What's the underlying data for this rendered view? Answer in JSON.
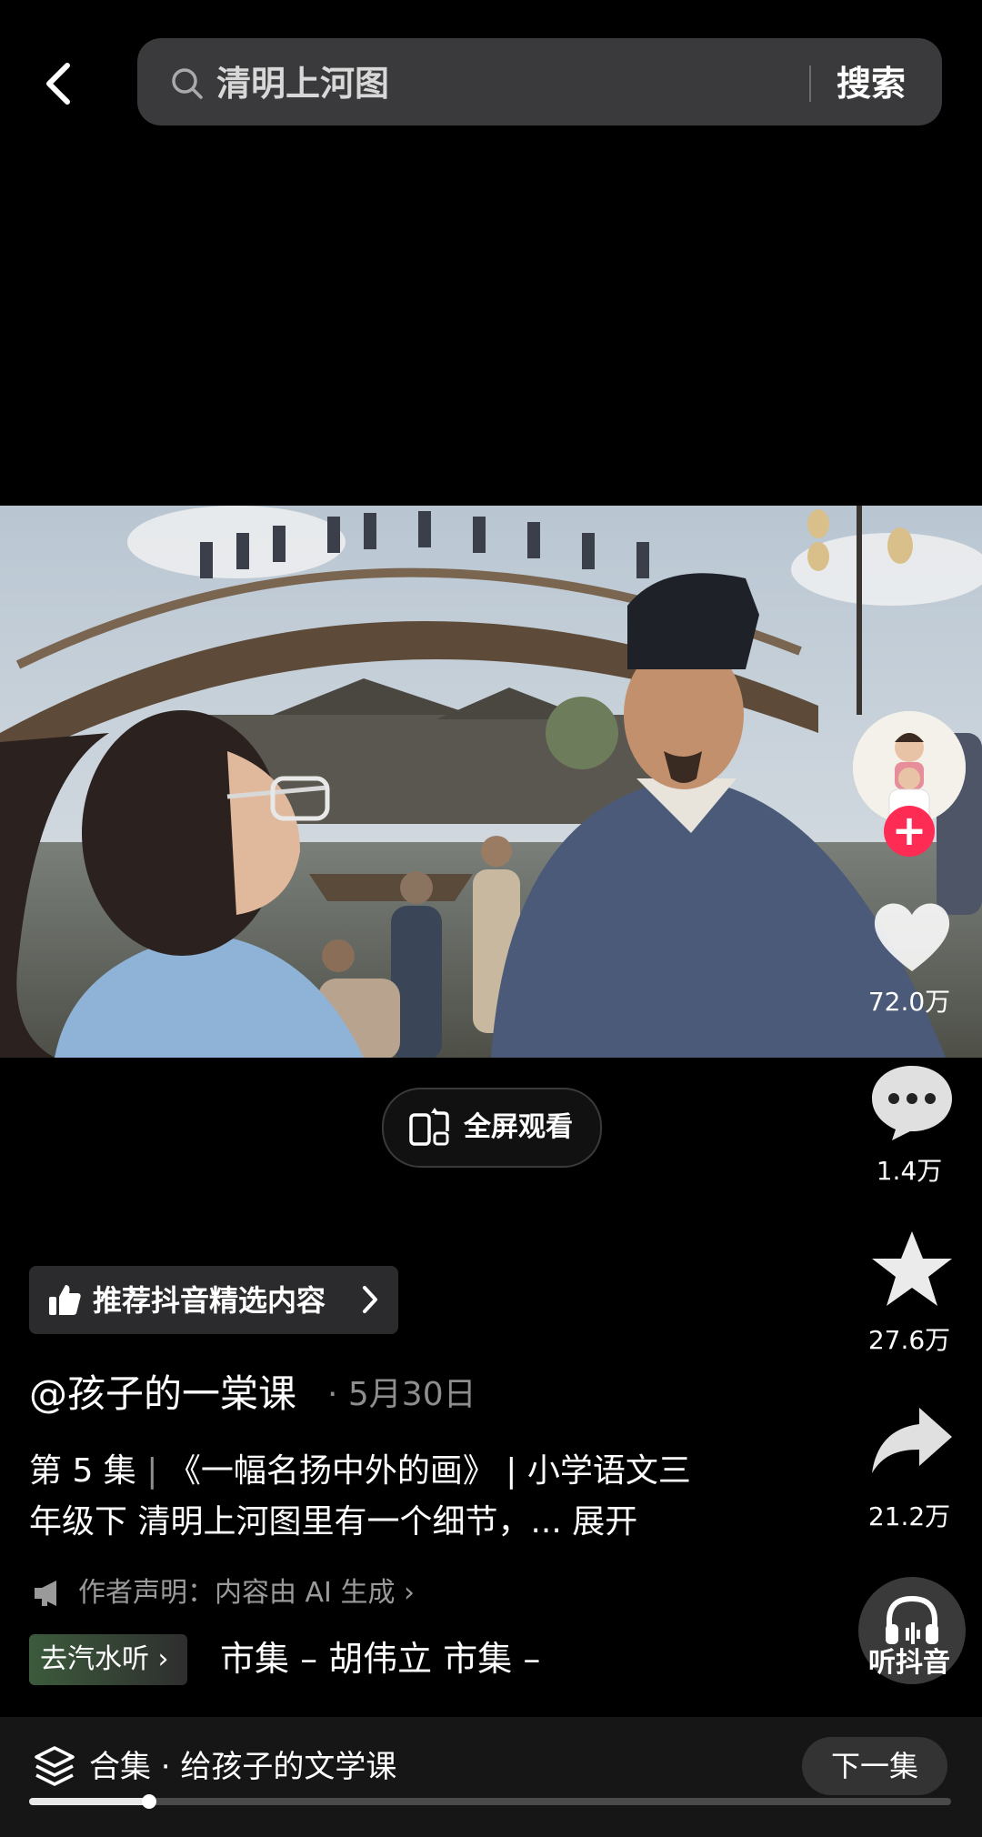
{
  "search": {
    "query": "清明上河图",
    "button_label": "搜索"
  },
  "player": {
    "fullscreen_label": "全屏观看"
  },
  "actions": {
    "likes": "72.0万",
    "comments": "1.4万",
    "favorites": "27.6万",
    "shares": "21.2万"
  },
  "recommend": {
    "label": "推荐抖音精选内容"
  },
  "post": {
    "author": "@孩子的一棠课",
    "date": "· 5月30日",
    "desc_line1_a": "第 5 集",
    "desc_line1_sep": "|",
    "desc_line1_b": "《一幅名扬中外的画》 | 小学语文三",
    "desc_line2": "年级下 清明上河图里有一个细节，... 展开",
    "ai_note": "作者声明：内容由 AI 生成 ›"
  },
  "music": {
    "tag_label": "去汽水听 ›",
    "track": "市集 – 胡伟立   市集 –"
  },
  "listen": {
    "label": "听抖音"
  },
  "collection": {
    "label": "合集 · 给孩子的文学课",
    "next_label": "下一集",
    "progress": 0.13
  },
  "colors": {
    "accent": "#fe2c55",
    "bg": "#000000",
    "bar": "#3a3a3c"
  },
  "icons": [
    "back-icon",
    "search-icon",
    "fullscreen-icon",
    "heart-icon",
    "comment-icon",
    "star-icon",
    "share-icon",
    "thumbs-up-icon",
    "megaphone-icon",
    "headphones-icon",
    "layers-icon",
    "chevron-down-icon"
  ]
}
